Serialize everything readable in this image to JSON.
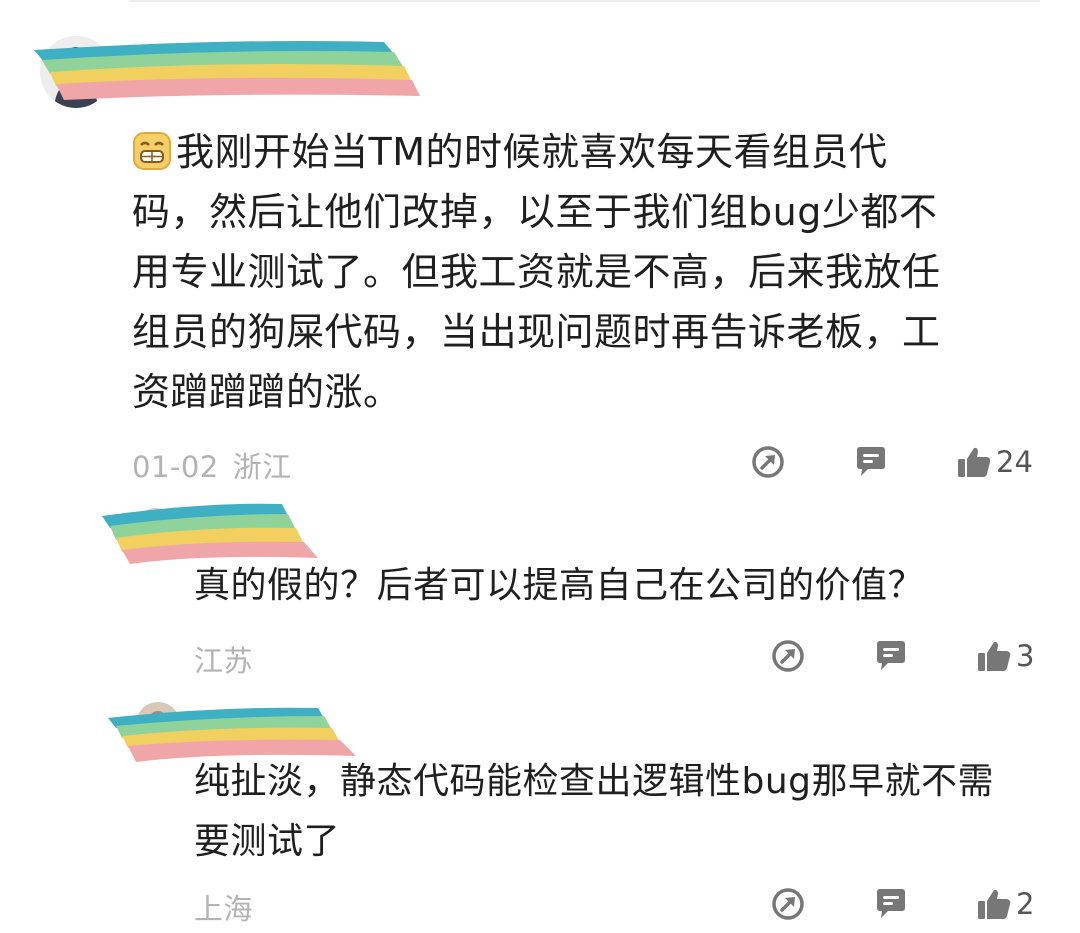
{
  "comments": [
    {
      "avatar": "user-avatar-icon",
      "text": "我刚开始当TM的时候就喜欢每天看组员代码，然后让他们改掉，以至于我们组bug少都不用专业测试了。但我工资就是不高，后来我放任组员的狗屎代码，当出现问题时再告诉老板，工资蹭蹭蹭的涨。",
      "lines": [
        "我刚开始当TM的时候就喜欢每天看组员代",
        "码，然后让他们改掉，以至于我们组bug少都不",
        "用专业测试了。但我工资就是不高，后来我放任",
        "组员的狗屎代码，当出现问题时再告诉老板，工",
        "资蹭蹭蹭的涨。"
      ],
      "date": "01-02",
      "location": "浙江",
      "likes": "24"
    },
    {
      "avatar": "user-avatar-icon",
      "lines": [
        "真的假的？后者可以提高自己在公司的价值？"
      ],
      "location": "江苏",
      "likes": "3"
    },
    {
      "avatar": "user-avatar-icon",
      "lines": [
        "纯扯淡，静态代码能检查出逻辑性bug那早就不需",
        "要测试了"
      ],
      "location": "上海",
      "likes": "2"
    }
  ],
  "icons": {
    "share": "share-icon",
    "reply": "comment-icon",
    "like": "thumbs-up-icon",
    "emoji": "grinning-emoji-icon"
  },
  "colors": {
    "redaction_stripes": [
      "#3fb0c4",
      "#8fd29a",
      "#f2d060",
      "#f0a6a8"
    ],
    "meta_text": "#b3b3b3",
    "icon_gray": "#777777"
  }
}
